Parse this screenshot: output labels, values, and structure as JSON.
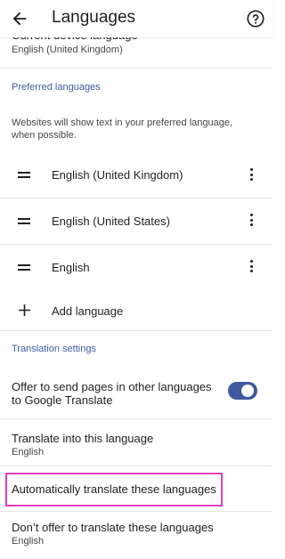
{
  "appbar": {
    "title": "Languages",
    "back_icon": "arrow-back-icon",
    "help_icon": "help-icon"
  },
  "device_language": {
    "title": "Current device language",
    "value": "English (United Kingdom)"
  },
  "preferred": {
    "header": "Preferred languages",
    "description_line1": "Websites will show text in your preferred language,",
    "description_line2": "when possible.",
    "languages": [
      {
        "label": "English (United Kingdom)"
      },
      {
        "label": "English (United States)"
      },
      {
        "label": "English"
      }
    ],
    "add_label": "Add language"
  },
  "translation": {
    "header": "Translation settings",
    "offer_line1": "Offer to send pages in other languages",
    "offer_line2": "to Google Translate",
    "offer_enabled": true,
    "translate_into_title": "Translate into this language",
    "translate_into_value": "English",
    "auto_translate_title": "Automatically translate these languages",
    "dont_offer_title": "Don’t offer to translate these languages",
    "dont_offer_value": "English"
  },
  "colors": {
    "accent": "#3e5a9c",
    "highlight": "#e13fbd"
  }
}
